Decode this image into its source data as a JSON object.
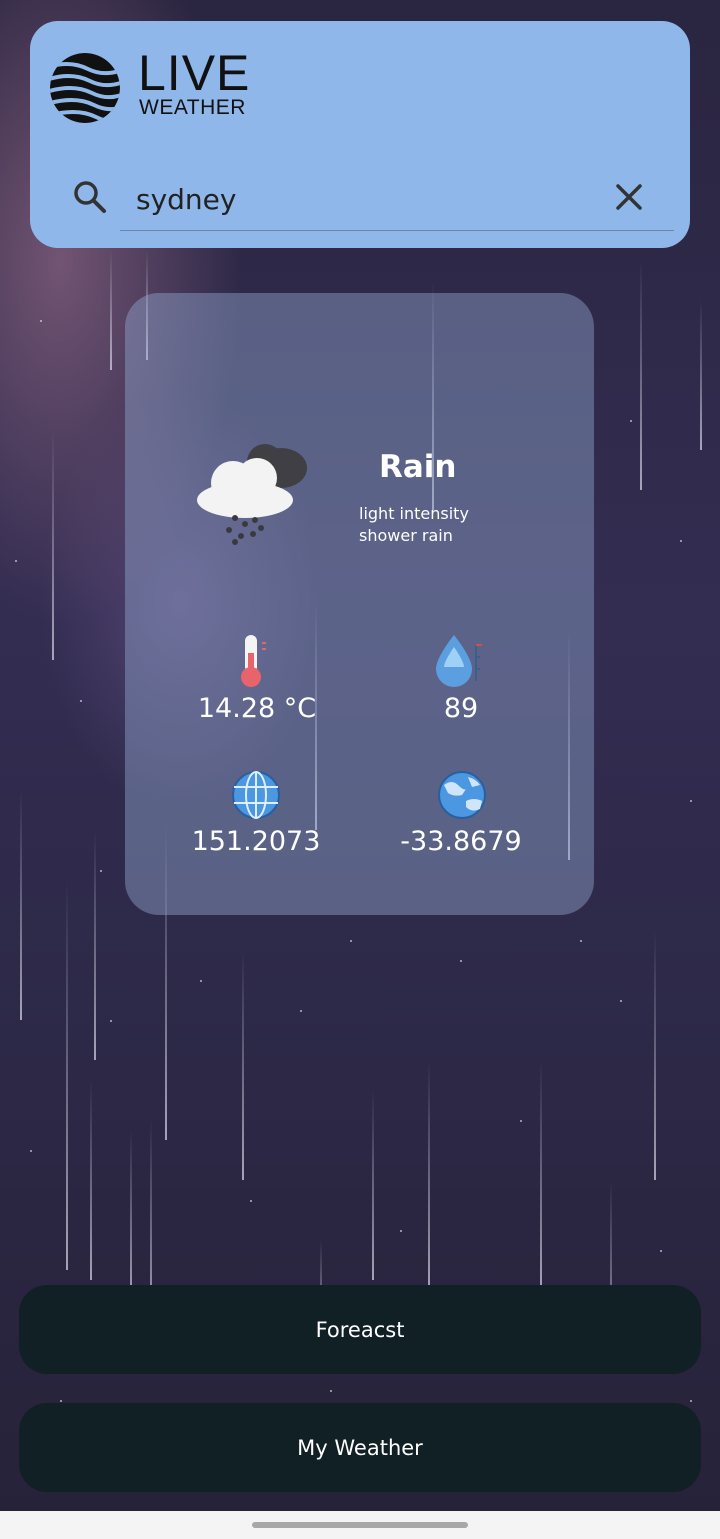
{
  "app": {
    "logo_word": "LIVE",
    "logo_sub": "WEATHER",
    "logo_icon": "striped-globe-icon"
  },
  "search": {
    "value": "sydney",
    "search_icon": "search-icon",
    "clear_icon": "close-icon"
  },
  "weather": {
    "condition": "Rain",
    "description": "light intensity shower rain",
    "condition_icon": "rain-cloud-icon",
    "temperature": "14.28 °C",
    "temperature_icon": "thermometer-icon",
    "humidity": "89",
    "humidity_icon": "water-drop-icon",
    "longitude": "151.2073",
    "longitude_icon": "globe-icon",
    "latitude": "-33.8679",
    "latitude_icon": "earth-icon"
  },
  "buttons": {
    "forecast": "Foreacst",
    "my_weather": "My Weather"
  },
  "colors": {
    "header_bg": "#8fb7e9",
    "button_bg": "#102025",
    "card_bg": "rgba(150,175,215,0.42)"
  }
}
